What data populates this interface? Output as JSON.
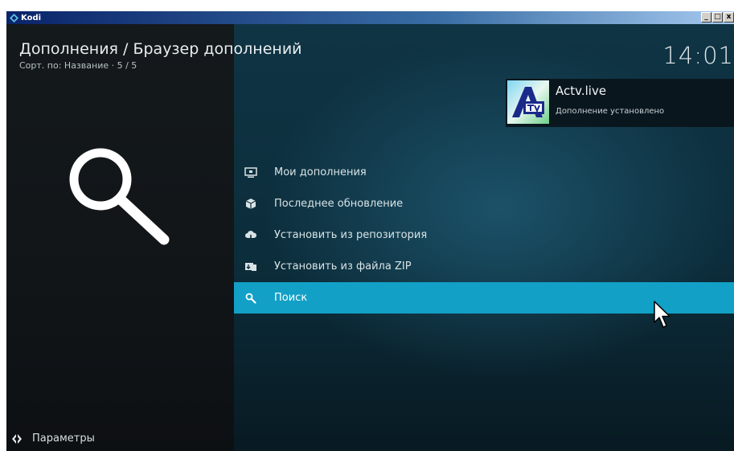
{
  "window": {
    "title": "Kodi",
    "controls": [
      "_",
      "□",
      "x"
    ]
  },
  "header": {
    "title": "Дополнения / Браузер дополнений",
    "subtitle": "Сорт. по: Название · 5 / 5",
    "clock": "14:01"
  },
  "notification": {
    "title": "Actv.live",
    "message": "Дополнение установлено"
  },
  "menu": {
    "items": [
      {
        "label": "Мои дополнения",
        "icon": "monitor-icon"
      },
      {
        "label": "Последнее обновление",
        "icon": "box-icon"
      },
      {
        "label": "Установить из репозитория",
        "icon": "cloud-download-icon"
      },
      {
        "label": "Установить из файла ZIP",
        "icon": "zip-install-icon"
      },
      {
        "label": "Поиск",
        "icon": "search-icon",
        "selected": true
      }
    ]
  },
  "footer": {
    "settings_label": "Параметры"
  },
  "colors": {
    "accent": "#12a0c7",
    "left_panel": "#14191c",
    "right_panel": "#0f3444"
  }
}
